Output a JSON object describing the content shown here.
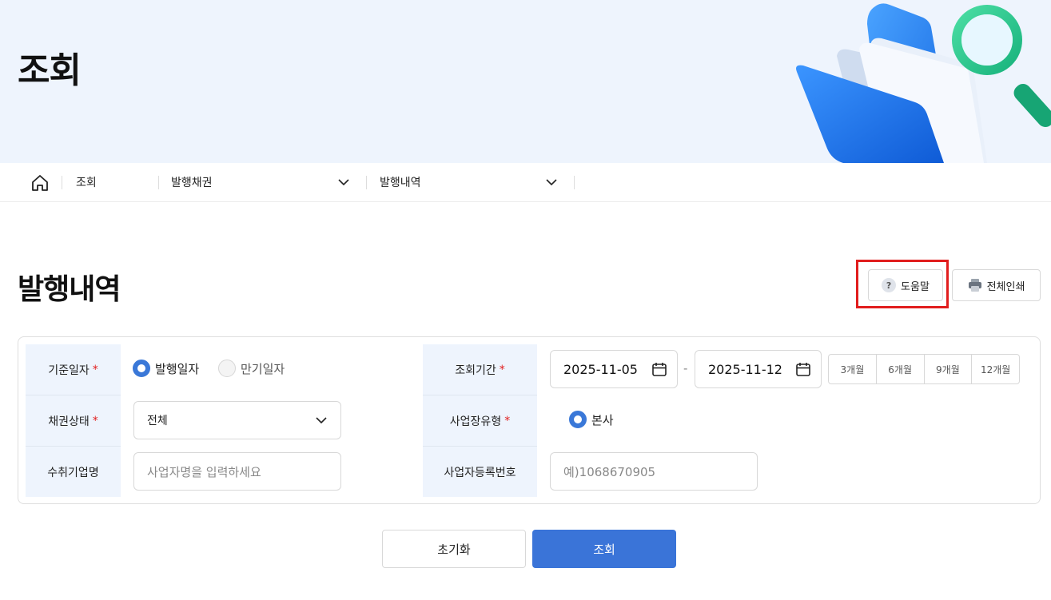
{
  "hero": {
    "title": "조회"
  },
  "breadcrumb": {
    "home_icon": "home-icon",
    "items": [
      {
        "label": "조회"
      },
      {
        "label": "발행채권"
      },
      {
        "label": "발행내역"
      }
    ]
  },
  "page": {
    "title": "발행내역"
  },
  "toolbar": {
    "help_label": "도움말",
    "help_icon": "question-icon",
    "print_label": "전체인쇄",
    "print_icon": "printer-icon"
  },
  "form": {
    "base_date": {
      "label": "기준일자",
      "required_mark": "*",
      "options": [
        {
          "label": "발행일자",
          "selected": true
        },
        {
          "label": "만기일자",
          "selected": false
        }
      ]
    },
    "bond_status": {
      "label": "채권상태",
      "required_mark": "*",
      "value": "전체"
    },
    "recipient_company": {
      "label": "수취기업명",
      "placeholder": "사업자명을 입력하세요"
    },
    "period": {
      "label": "조회기간",
      "required_mark": "*",
      "start": "2025-11-05",
      "separator": "-",
      "end": "2025-11-12",
      "quick_ranges": [
        "3개월",
        "6개월",
        "9개월",
        "12개월"
      ]
    },
    "business_type": {
      "label": "사업장유형",
      "required_mark": "*",
      "option": {
        "label": "본사",
        "selected": true
      }
    },
    "business_number": {
      "label": "사업자등록번호",
      "placeholder": "예)1068670905"
    }
  },
  "actions": {
    "reset_label": "초기화",
    "search_label": "조회"
  },
  "colors": {
    "primary": "#3a74d8",
    "hero_bg": "#eef4fd",
    "required": "#e11d1d",
    "highlight": "#e11d1d"
  }
}
